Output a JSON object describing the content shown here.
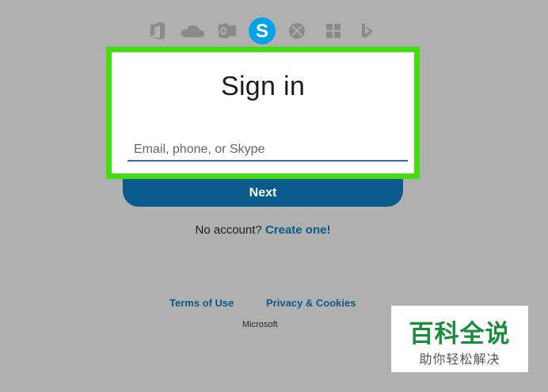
{
  "app_icons": [
    "office-icon",
    "onedrive-icon",
    "outlook-icon",
    "skype-icon",
    "xbox-icon",
    "windows-icon",
    "bing-icon"
  ],
  "signin": {
    "title": "Sign in",
    "email_placeholder": "Email, phone, or Skype",
    "email_value": "",
    "next_label": "Next",
    "no_account_text": "No account?",
    "create_link": "Create one!"
  },
  "footer": {
    "terms": "Terms of Use",
    "privacy": "Privacy & Cookies",
    "brand": "Microsoft"
  },
  "watermark": {
    "title": "百科全说",
    "subtitle": "助你轻松解决"
  },
  "colors": {
    "background": "#b0b0b0",
    "highlight": "#44dd11",
    "accent": "#0a5b8c",
    "skype_blue": "#00a2e8",
    "icon_gray": "#8a8a8a",
    "watermark_green": "#1a8c3b"
  }
}
